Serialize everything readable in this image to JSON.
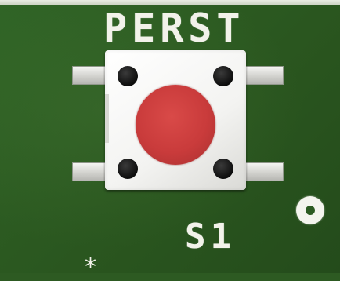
{
  "silkscreen": {
    "switch_label": "PERST",
    "designator": "S1",
    "pin1_marker": "*"
  },
  "colors": {
    "board": "#2d5a22",
    "silkscreen": "#f2f2ea",
    "switch_body": "#f3f3f1",
    "actuator": "#c93b3b"
  }
}
